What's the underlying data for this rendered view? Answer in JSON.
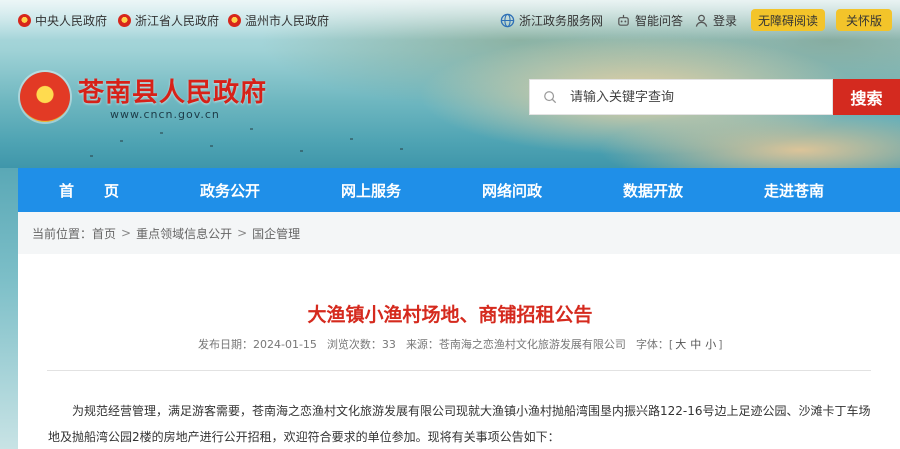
{
  "topbar": {
    "left_links": [
      {
        "label": "中央人民政府"
      },
      {
        "label": "浙江省人民政府"
      },
      {
        "label": "温州市人民政府"
      }
    ],
    "right_links": [
      {
        "label": "浙江政务服务网",
        "icon": "globe-icon"
      },
      {
        "label": "智能问答",
        "icon": "robot-icon"
      },
      {
        "label": "登录",
        "icon": "user-icon"
      }
    ],
    "accessibility_label": "无障碍阅读",
    "elder_label": "关怀版"
  },
  "logo": {
    "title": "苍南县人民政府",
    "url": "www.cncn.gov.cn"
  },
  "search": {
    "placeholder": "请输入关键字查询",
    "button_label": "搜索"
  },
  "nav": {
    "items": [
      {
        "label": "首　　页"
      },
      {
        "label": "政务公开"
      },
      {
        "label": "网上服务"
      },
      {
        "label": "网络问政"
      },
      {
        "label": "数据开放"
      },
      {
        "label": "走进苍南"
      }
    ],
    "color": "#1f8fe8"
  },
  "breadcrumb": {
    "prefix": "当前位置：",
    "items": [
      "首页",
      "重点领域信息公开",
      "国企管理"
    ],
    "separator": ">"
  },
  "article": {
    "title": "大渔镇小渔村场地、商铺招租公告",
    "meta": {
      "date": "发布日期：2024-01-15",
      "views": "浏览次数：33",
      "source": "来源：苍南海之恋渔村文化旅游发展有限公司",
      "fontsize_label": "字体：[",
      "fontsize_big": "大",
      "fontsize_mid": "中",
      "fontsize_small": "小",
      "fontsize_end": "]"
    },
    "paragraph": "为规范经营管理，满足游客需要，苍南海之恋渔村文化旅游发展有限公司现就大渔镇小渔村抛船湾围垦内振兴路122-16号边上足迹公园、沙滩卡丁车场地及抛船湾公园2楼的房地产进行公开招租，欢迎符合要求的单位参加。现将有关事项公告如下："
  },
  "colors": {
    "accent_red": "#d42a1f",
    "nav_blue": "#1f8fe8",
    "pill_yellow": "#f3c42a"
  }
}
